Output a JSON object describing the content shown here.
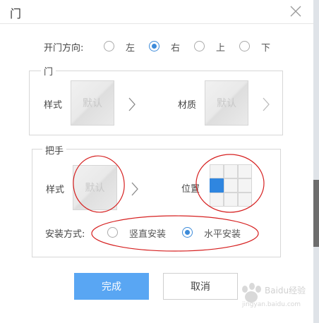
{
  "dialog": {
    "title": "门"
  },
  "open_direction": {
    "label": "开门方向:",
    "options": [
      {
        "label": "左",
        "checked": false
      },
      {
        "label": "右",
        "checked": true
      },
      {
        "label": "上",
        "checked": false
      },
      {
        "label": "下",
        "checked": false
      }
    ]
  },
  "door_group": {
    "legend": "门",
    "style_label": "样式",
    "style_value": "默认",
    "material_label": "材质",
    "material_value": "默认"
  },
  "handle_group": {
    "legend": "把手",
    "style_label": "样式",
    "style_value": "默认",
    "position_label": "位置",
    "position_grid": {
      "rows": 3,
      "cols": 3,
      "selected_row": 2,
      "selected_col": 1
    },
    "install_label": "安装方式:",
    "install_options": [
      {
        "label": "竖直安装",
        "checked": false
      },
      {
        "label": "水平安装",
        "checked": true
      }
    ]
  },
  "buttons": {
    "confirm": "完成",
    "cancel": "取消"
  },
  "watermark": {
    "text": "Baidu经验",
    "sub": "jingyan.baidu.com"
  },
  "colors": {
    "primary": "#59a6f3",
    "accent": "#2f86e0",
    "annotation": "#d62020"
  }
}
